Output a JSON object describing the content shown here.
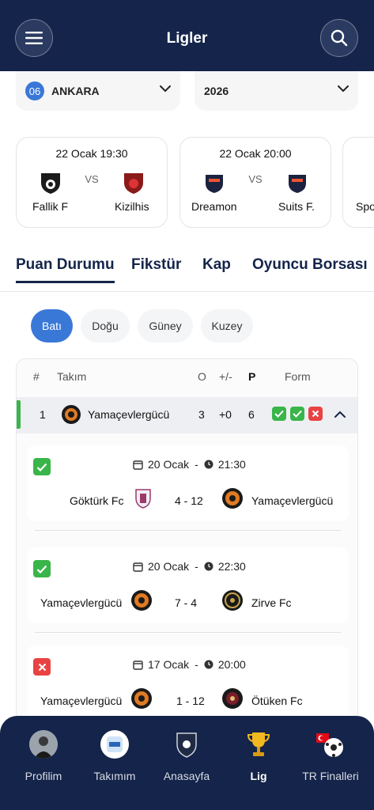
{
  "header": {
    "title": "Ligler",
    "menu_icon": "menu-icon",
    "search_icon": "search-icon"
  },
  "filters": {
    "city_code": "06",
    "city": "ANKARA",
    "year": "2026"
  },
  "fixtures": [
    {
      "time": "22 Ocak  19:30",
      "vs": "VS",
      "home": "Fallik F",
      "away": "Kizilhis"
    },
    {
      "time": "22 Ocak  20:00",
      "vs": "VS",
      "home": "Dreamon",
      "away": "Suits F."
    },
    {
      "time": "",
      "vs": "",
      "home": "Spo",
      "away": ""
    }
  ],
  "tabs": [
    {
      "label": "Puan Durumu",
      "active": true
    },
    {
      "label": "Fikstür",
      "active": false
    },
    {
      "label": "Kap",
      "active": false
    },
    {
      "label": "Oyuncu Borsası",
      "active": false
    }
  ],
  "regions": [
    {
      "label": "Batı",
      "active": true
    },
    {
      "label": "Doğu",
      "active": false
    },
    {
      "label": "Güney",
      "active": false
    },
    {
      "label": "Kuzey",
      "active": false
    }
  ],
  "standings": {
    "headers": {
      "rank": "#",
      "team": "Takım",
      "played": "O",
      "diff": "+/-",
      "points": "P",
      "form": "Form"
    },
    "rows": [
      {
        "rank": "1",
        "team": "Yamaçevlergücü",
        "played": "3",
        "diff": "+0",
        "points": "6",
        "form": [
          "W",
          "W",
          "L"
        ]
      }
    ]
  },
  "matches": [
    {
      "result": "W",
      "date": "20 Ocak",
      "time": "21:30",
      "home": "Göktürk Fc",
      "score": "4 - 12",
      "away": "Yamaçevlergücü"
    },
    {
      "result": "W",
      "date": "20 Ocak",
      "time": "22:30",
      "home": "Yamaçevlergücü",
      "score": "7 - 4",
      "away": "Zirve Fc"
    },
    {
      "result": "L",
      "date": "17 Ocak",
      "time": "20:00",
      "home": "Yamaçevlergücü",
      "score": "1 - 12",
      "away": "Ötüken Fc"
    }
  ],
  "date_separator": "-",
  "nav": [
    {
      "label": "Profilim",
      "icon": "profile-photo-icon",
      "active": false
    },
    {
      "label": "Takımım",
      "icon": "team-badge-icon",
      "active": false
    },
    {
      "label": "Anasayfa",
      "icon": "league-shield-icon",
      "active": false
    },
    {
      "label": "Lig",
      "icon": "trophy-icon",
      "active": true
    },
    {
      "label": "TR Finalleri",
      "icon": "turkey-ball-icon",
      "active": false
    }
  ],
  "colors": {
    "navy": "#14244a",
    "accent_blue": "#3a78d8",
    "win": "#39b54a",
    "loss": "#e94242"
  }
}
